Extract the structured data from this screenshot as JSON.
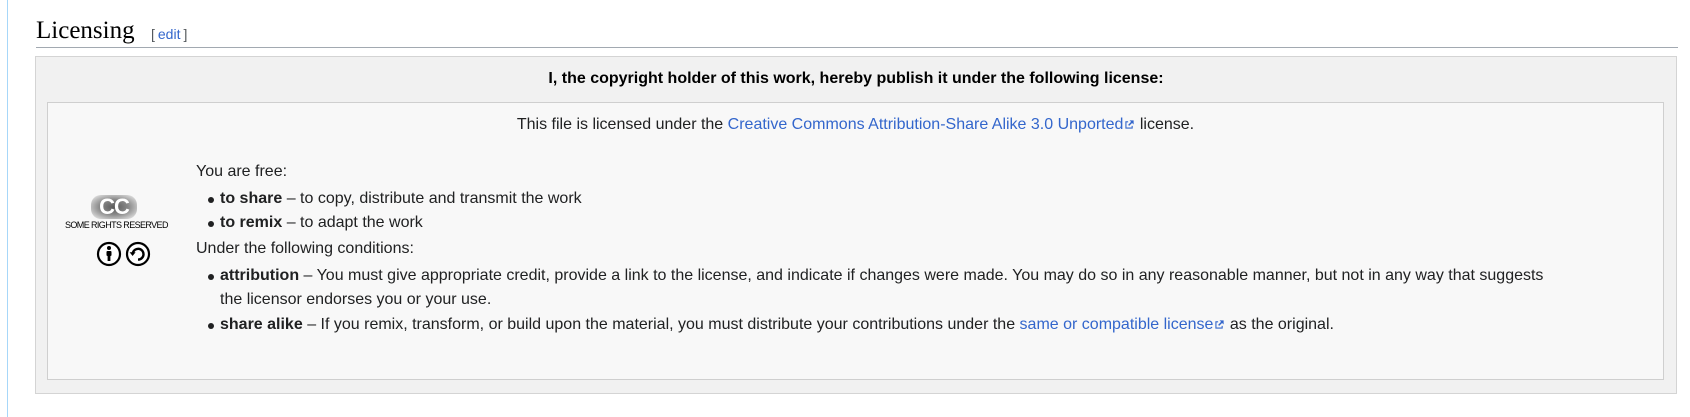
{
  "section": {
    "title": "Licensing",
    "edit_open": "[",
    "edit_label": "edit",
    "edit_close": "]"
  },
  "license_box": {
    "header": "I, the copyright holder of this work, hereby publish it under the following license:",
    "licensed_prefix": "This file is licensed under the",
    "license_link": "Creative Commons Attribution-Share Alike 3.0 Unported",
    "licensed_suffix": "license.",
    "logo_text": "CC",
    "logo_caption": "SOME RIGHTS RESERVED",
    "free_intro": "You are free:",
    "freedoms": [
      {
        "term": "to share",
        "desc": "– to copy, distribute and transmit the work"
      },
      {
        "term": "to remix",
        "desc": "– to adapt the work"
      }
    ],
    "conditions_intro": "Under the following conditions:",
    "conditions": [
      {
        "term": "attribution",
        "desc_line1": "– You must give appropriate credit, provide a link to the license, and indicate if changes were made. You may do so in any reasonable manner, but not in any way that suggests",
        "desc_line2": "the licensor endorses you or your use."
      },
      {
        "term": "share alike",
        "desc_prefix": "– If you remix, transform, or build upon the material, you must distribute your contributions under the",
        "link": "same or compatible license",
        "desc_suffix": "as the original."
      }
    ]
  },
  "colors": {
    "link": "#3366cc",
    "text": "#202122",
    "outer_bg": "#f1f1f1",
    "inner_bg": "#f8f8f8"
  }
}
